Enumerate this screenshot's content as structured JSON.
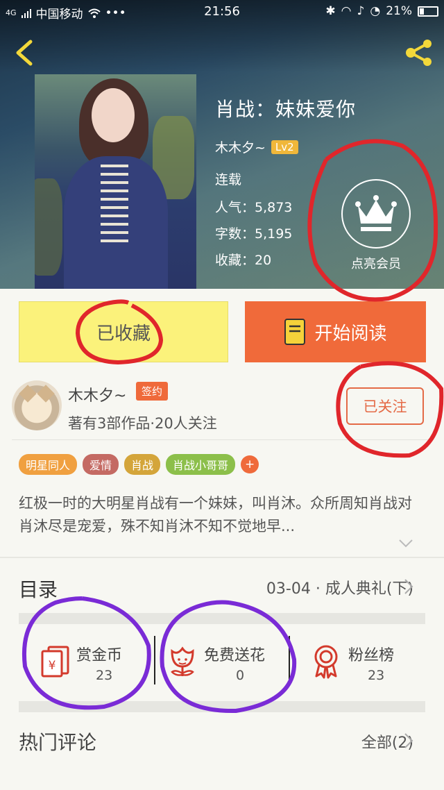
{
  "status_bar": {
    "network": "4G",
    "carrier": "中国移动",
    "time": "21:56",
    "battery": "21%"
  },
  "book": {
    "title": "肖战：妹妹爱你",
    "author": "木木夕~",
    "author_level": "Lv2",
    "status": "连载",
    "popularity": "人气：5,873",
    "words": "字数：5,195",
    "favorites": "收藏：20"
  },
  "vip": {
    "label": "点亮会员"
  },
  "actions": {
    "favorite_label": "已收藏",
    "read_label": "开始阅读"
  },
  "author_card": {
    "name": "木木夕~",
    "sign_badge": "签约",
    "summary": "著有3部作品·20人关注",
    "follow_label": "已关注"
  },
  "tags": [
    {
      "label": "明星同人",
      "color": "#f0a040"
    },
    {
      "label": "爱情",
      "color": "#c46a63"
    },
    {
      "label": "肖战",
      "color": "#d4a53a"
    },
    {
      "label": "肖战小哥哥",
      "color": "#8cbf4a"
    }
  ],
  "tag_more": "+",
  "description": "红极一时的大明星肖战有一个妹妹，叫肖沐。众所周知肖战对肖沐尽是宠爱，殊不知肖沐不知不觉地早...",
  "toc": {
    "label": "目录",
    "latest_chapter": "03-04 · 成人典礼(下)"
  },
  "stats": [
    {
      "label": "赏金币",
      "value": "23",
      "icon": "red-envelope-icon"
    },
    {
      "label": "免费送花",
      "value": "0",
      "icon": "flower-icon"
    },
    {
      "label": "粉丝榜",
      "value": "23",
      "icon": "medal-icon"
    }
  ],
  "comments": {
    "label": "热门评论",
    "all_label": "全部(2)"
  },
  "colors": {
    "accent": "#f06a3a",
    "favorite_bg": "#fbf27b",
    "annotation_red": "#e0262b",
    "annotation_purple": "#7a2bd6"
  }
}
